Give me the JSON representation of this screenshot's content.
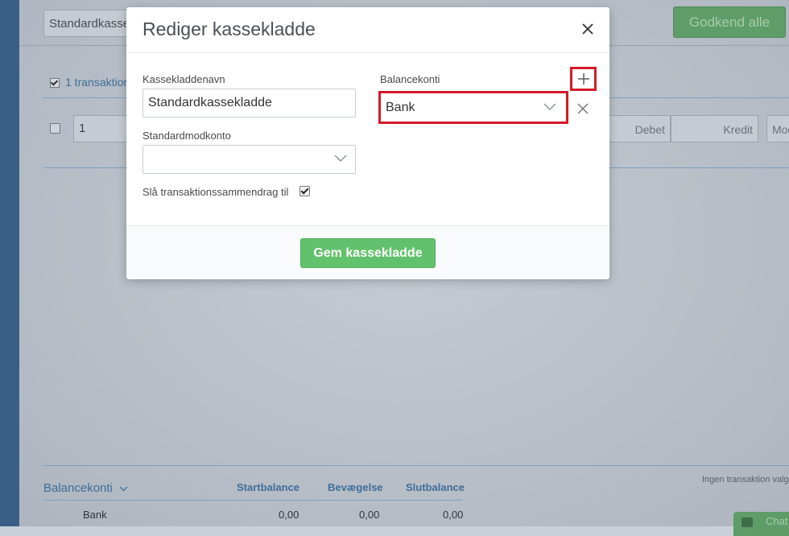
{
  "background": {
    "journal_select_value": "Standardkassekladde",
    "approve_all_label": "Godkend alle",
    "transactions_count_label": "1 transaktion",
    "row_number": "1",
    "col_debet": "Debet",
    "col_kredit": "Kredit",
    "col_mod": "Modkonto",
    "no_transactions_label": "Ingen transaktion valgt",
    "balance_table": {
      "title": "Balancekonti",
      "headers": [
        "Startbalance",
        "Bevægelse",
        "Slutbalance"
      ],
      "rows": [
        {
          "account": "Bank",
          "start": "0,00",
          "movement": "0,00",
          "end": "0,00"
        }
      ]
    },
    "chat_label": "Chat"
  },
  "modal": {
    "title": "Rediger kassekladde",
    "name_label": "Kassekladdenavn",
    "name_value": "Standardkassekladde",
    "counter_account_label": "Standardmodkonto",
    "counter_account_value": "",
    "summary_toggle_label": "Slå transaktionssammendrag til",
    "summary_toggle_checked": true,
    "balance_accounts_label": "Balancekonti",
    "balance_account_value": "Bank",
    "save_label": "Gem kassekladde"
  },
  "colors": {
    "accent_green": "#62c16c",
    "highlight_red": "#d51a2a",
    "link_blue": "#3f6e99"
  },
  "icons": [
    "close-icon",
    "plus-icon",
    "remove-icon",
    "chevron-down-icon",
    "checkbox-icon"
  ]
}
